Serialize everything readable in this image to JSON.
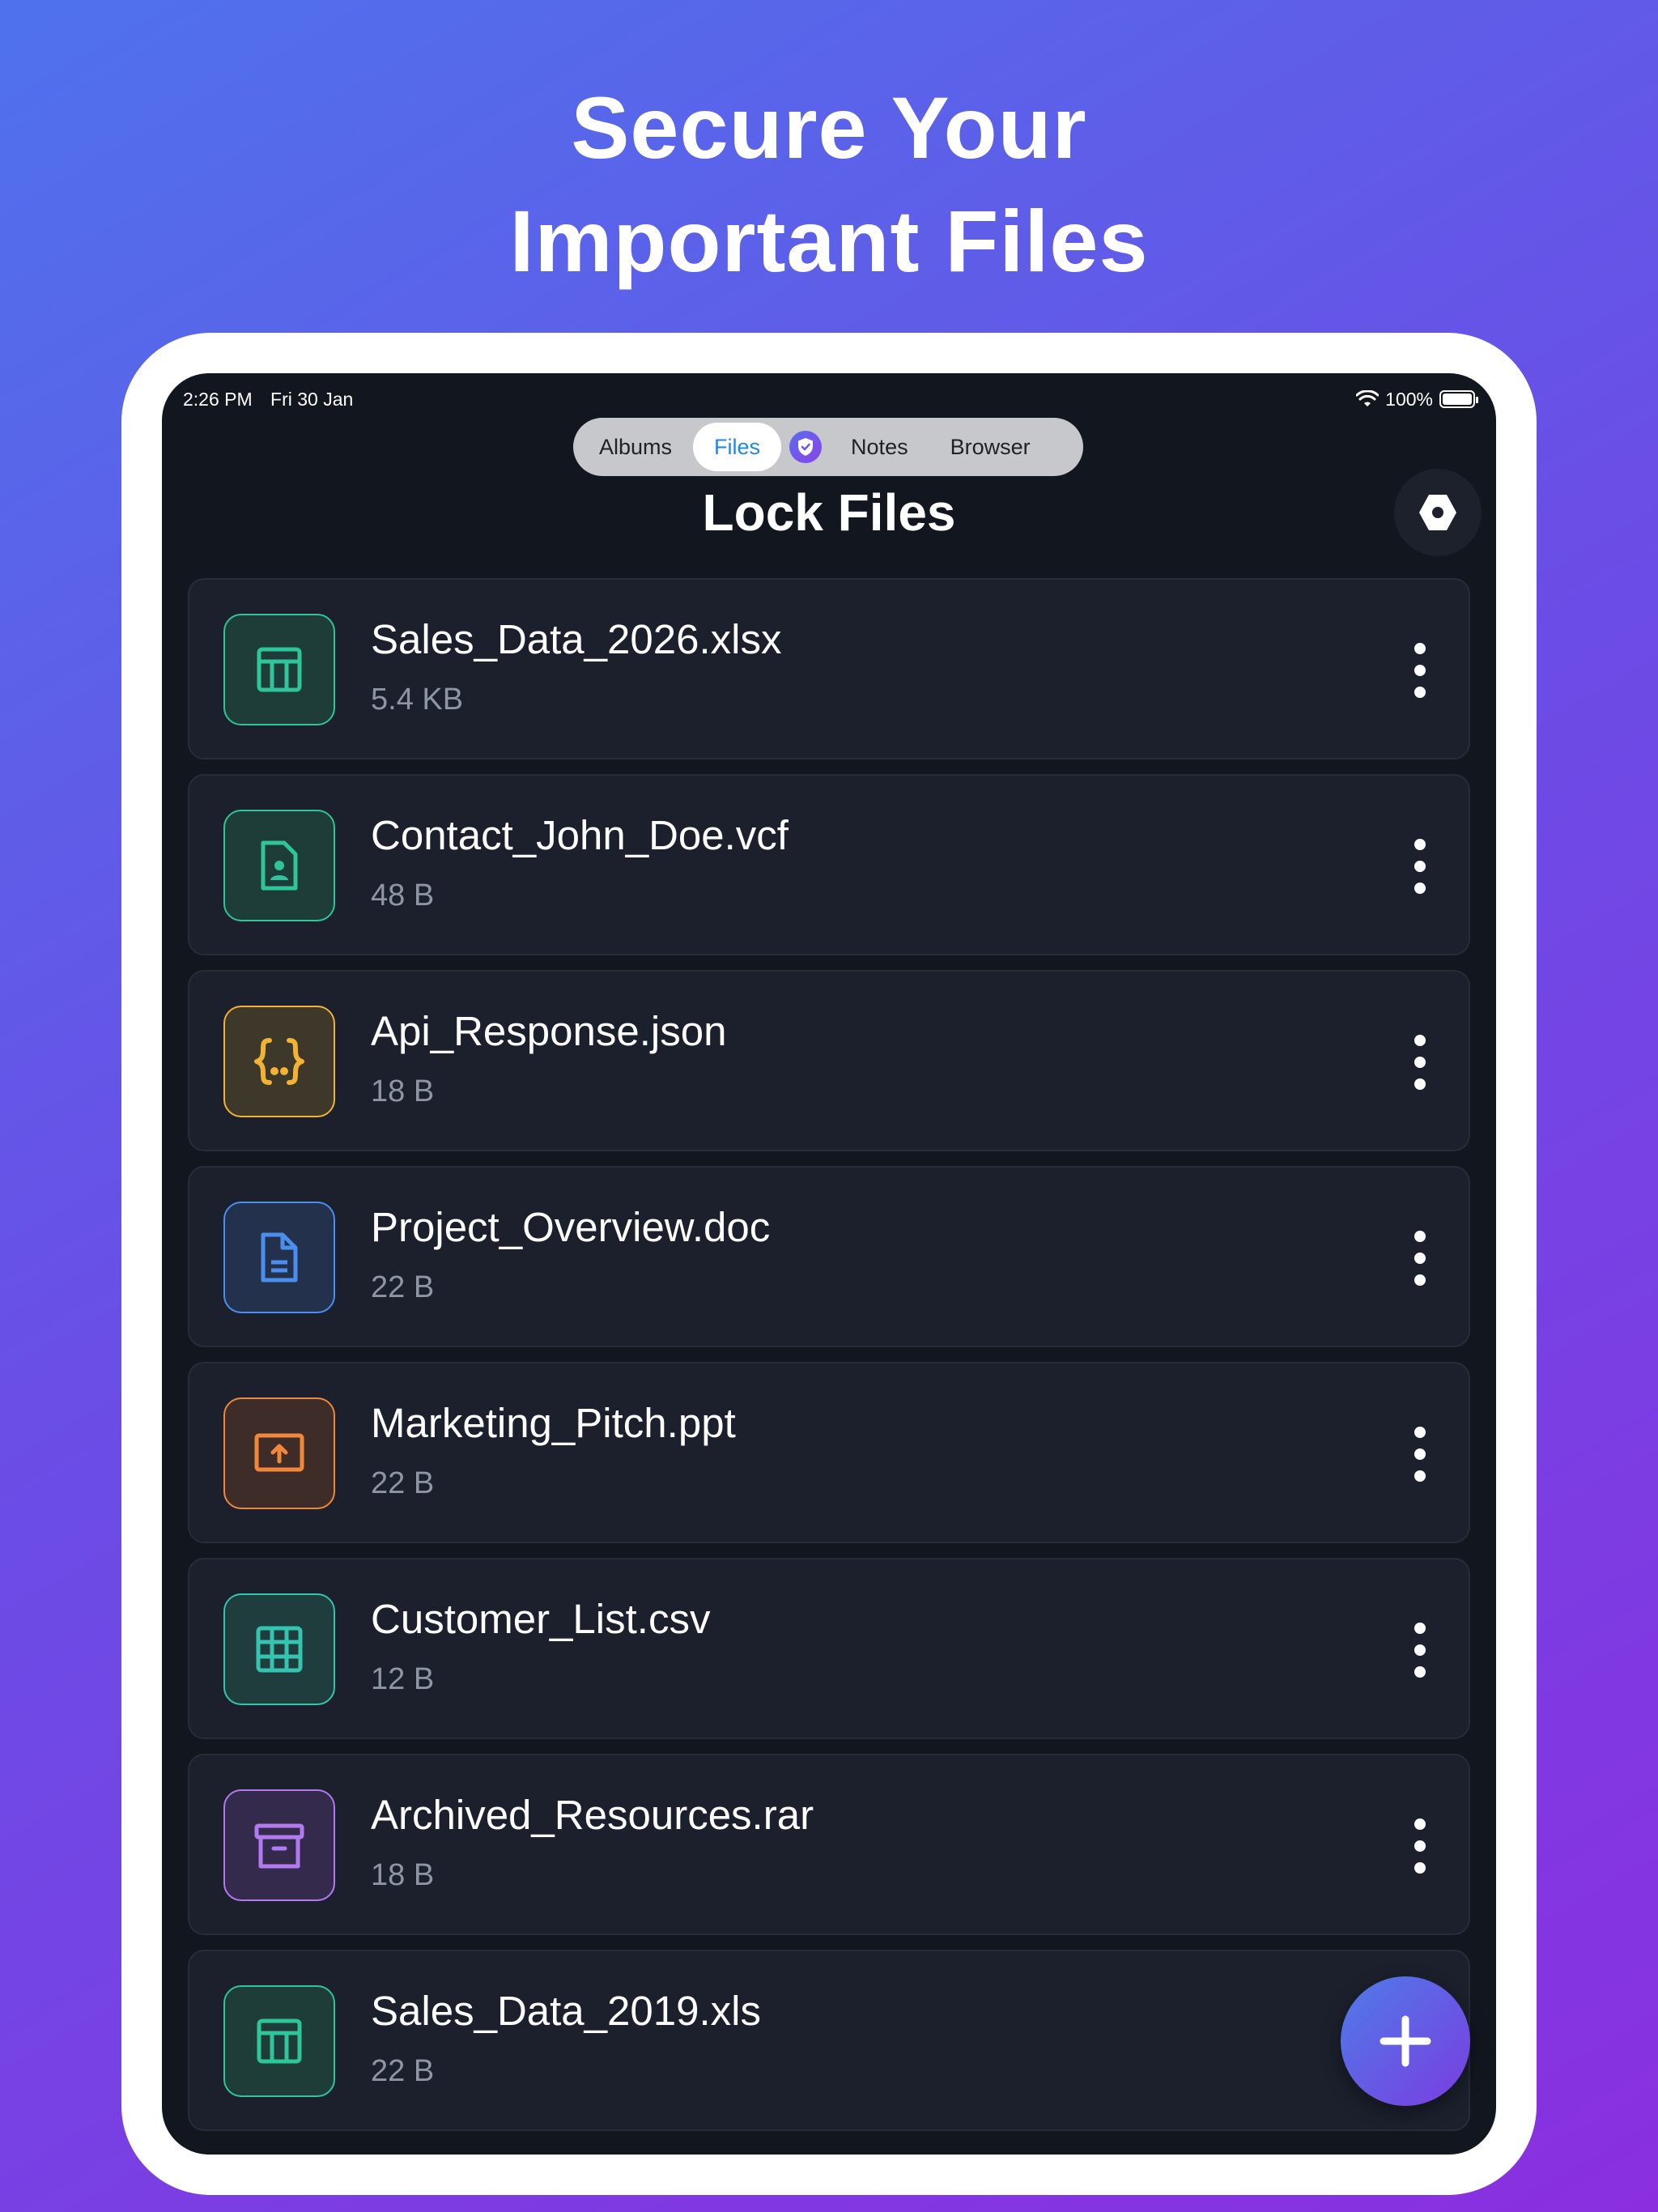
{
  "headline": {
    "line1": "Secure Your",
    "line2": "Important Files"
  },
  "status_bar": {
    "time": "2:26 PM",
    "date": "Fri 30 Jan",
    "battery": "100%"
  },
  "tabs": [
    {
      "label": "Albums",
      "active": false
    },
    {
      "label": "Files",
      "active": true
    },
    {
      "label": "Notes",
      "active": false
    },
    {
      "label": "Browser",
      "active": false
    }
  ],
  "page_title": "Lock Files",
  "files": [
    {
      "name": "Sales_Data_2026.xlsx",
      "size": "5.4 KB",
      "icon": "spreadsheet-icon",
      "color": "#2fc49a"
    },
    {
      "name": "Contact_John_Doe.vcf",
      "size": "48 B",
      "icon": "contact-file-icon",
      "color": "#2fc49a"
    },
    {
      "name": "Api_Response.json",
      "size": "18 B",
      "icon": "json-braces-icon",
      "color": "#f2b233"
    },
    {
      "name": "Project_Overview.doc",
      "size": "22 B",
      "icon": "document-icon",
      "color": "#4a8ef0"
    },
    {
      "name": "Marketing_Pitch.ppt",
      "size": "22 B",
      "icon": "presentation-icon",
      "color": "#f2873a"
    },
    {
      "name": "Customer_List.csv",
      "size": "12 B",
      "icon": "grid-table-icon",
      "color": "#35c4b0"
    },
    {
      "name": "Archived_Resources.rar",
      "size": "18 B",
      "icon": "archive-box-icon",
      "color": "#b27af0"
    },
    {
      "name": "Sales_Data_2019.xls",
      "size": "22 B",
      "icon": "spreadsheet-icon",
      "color": "#2fc49a"
    }
  ]
}
